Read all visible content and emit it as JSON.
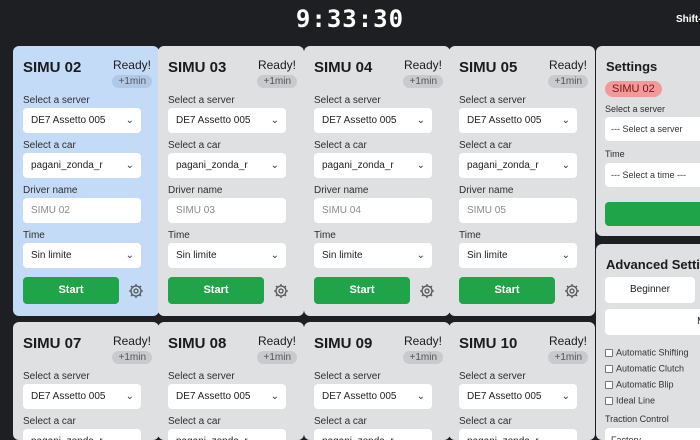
{
  "clock": "9:33:30",
  "shift_hint": "Shift-",
  "cards": [
    {
      "title": "SIMU 02",
      "ready": "Ready!",
      "badge": "+1min",
      "server_label": "Select a server",
      "server": "DE7 Assetto 005",
      "car_label": "Select a car",
      "car": "pagani_zonda_r",
      "driver_label": "Driver name",
      "driver_placeholder": "SIMU 02",
      "time_label": "Time",
      "time": "Sin limite",
      "start": "Start"
    },
    {
      "title": "SIMU 03",
      "ready": "Ready!",
      "badge": "+1min",
      "server_label": "Select a server",
      "server": "DE7 Assetto 005",
      "car_label": "Select a car",
      "car": "pagani_zonda_r",
      "driver_label": "Driver name",
      "driver_placeholder": "SIMU 03",
      "time_label": "Time",
      "time": "Sin limite",
      "start": "Start"
    },
    {
      "title": "SIMU 04",
      "ready": "Ready!",
      "badge": "+1min",
      "server_label": "Select a server",
      "server": "DE7 Assetto 005",
      "car_label": "Select a car",
      "car": "pagani_zonda_r",
      "driver_label": "Driver name",
      "driver_placeholder": "SIMU 04",
      "time_label": "Time",
      "time": "Sin limite",
      "start": "Start"
    },
    {
      "title": "SIMU 05",
      "ready": "Ready!",
      "badge": "+1min",
      "server_label": "Select a server",
      "server": "DE7 Assetto 005",
      "car_label": "Select a car",
      "car": "pagani_zonda_r",
      "driver_label": "Driver name",
      "driver_placeholder": "SIMU 05",
      "time_label": "Time",
      "time": "Sin limite",
      "start": "Start"
    },
    {
      "title": "SIMU 07",
      "ready": "Ready!",
      "badge": "+1min",
      "server_label": "Select a server",
      "server": "DE7 Assetto 005",
      "car_label": "Select a car",
      "car": "pagani_zonda_r"
    },
    {
      "title": "SIMU 08",
      "ready": "Ready!",
      "badge": "+1min",
      "server_label": "Select a server",
      "server": "DE7 Assetto 005",
      "car_label": "Select a car",
      "car": "pagani_zonda_r"
    },
    {
      "title": "SIMU 09",
      "ready": "Ready!",
      "badge": "+1min",
      "server_label": "Select a server",
      "server": "DE7 Assetto 005",
      "car_label": "Select a car",
      "car": "pagani_zonda_r"
    },
    {
      "title": "SIMU 10",
      "ready": "Ready!",
      "badge": "+1min",
      "server_label": "Select a server",
      "server": "DE7 Assetto 005",
      "car_label": "Select a car",
      "car": "pagani_zonda_r"
    }
  ],
  "settings": {
    "title": "Settings",
    "selected": "SIMU 02",
    "server_label": "Select a server",
    "server_placeholder": "--- Select a server",
    "time_label": "Time",
    "time_placeholder": "--- Select a time ---"
  },
  "advanced": {
    "title": "Advanced Setti",
    "beginner": "Beginner",
    "mode2": "Mo",
    "checks": [
      "Automatic Shifting",
      "Automatic Clutch",
      "Automatic Blip",
      "Ideal Line"
    ],
    "traction_label": "Traction Control",
    "traction_value": "Factory"
  },
  "colors": {
    "accent_green": "#1fa44a",
    "selected_card": "#c4dbf8",
    "selected_chip": "#f29a9a"
  }
}
